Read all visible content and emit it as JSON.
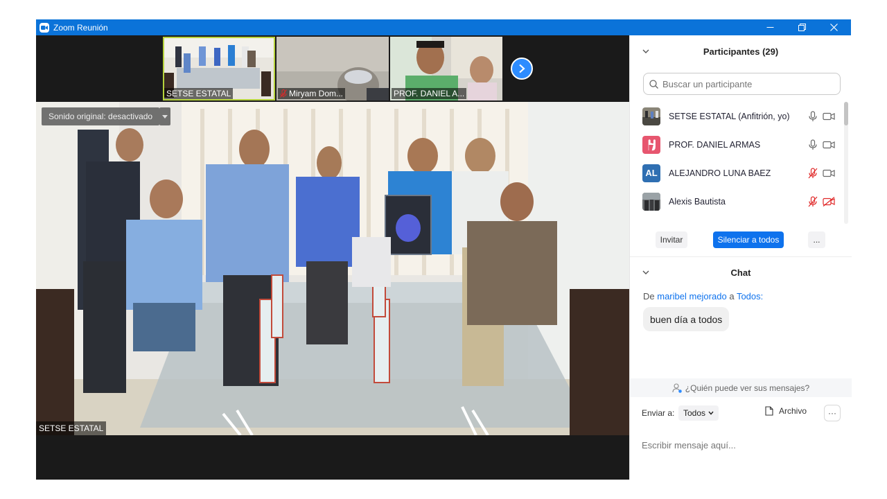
{
  "window": {
    "title": "Zoom Reunión",
    "accent": "#0b73d9"
  },
  "thumbnails": [
    {
      "label": "SETSE ESTATAL",
      "muted": false,
      "active": true
    },
    {
      "label": "Miryam Dom...",
      "muted": true,
      "active": false
    },
    {
      "label": "PROF. DANIEL A...",
      "muted": false,
      "active": false
    }
  ],
  "video": {
    "sound_button": "Sonido original: desactivado",
    "speaker_label": "SETSE ESTATAL"
  },
  "participants": {
    "header": "Participantes (29)",
    "search_placeholder": "Buscar un participante",
    "items": [
      {
        "name": "SETSE ESTATAL (Anfitrión, yo)",
        "mic": "on",
        "video": "on"
      },
      {
        "name": "PROF. DANIEL ARMAS",
        "mic": "on",
        "video": "on"
      },
      {
        "name": "ALEJANDRO LUNA BAEZ",
        "initials": "AL",
        "mic": "muted",
        "video": "on"
      },
      {
        "name": "Alexis Bautista",
        "mic": "muted",
        "video": "off"
      }
    ],
    "buttons": {
      "invite": "Invitar",
      "mute_all": "Silenciar a todos",
      "more": "..."
    }
  },
  "chat": {
    "header": "Chat",
    "from_prefix": "De",
    "sender": "maribel mejorado",
    "to_word": "a",
    "recipient": "Todos:",
    "message": "buen día a todos",
    "who_can_see": "¿Quién puede ver sus mensajes?",
    "send_to_label": "Enviar a:",
    "send_to_value": "Todos",
    "file_label": "Archivo",
    "more": "···",
    "input_placeholder": "Escribir mensaje aquí..."
  }
}
